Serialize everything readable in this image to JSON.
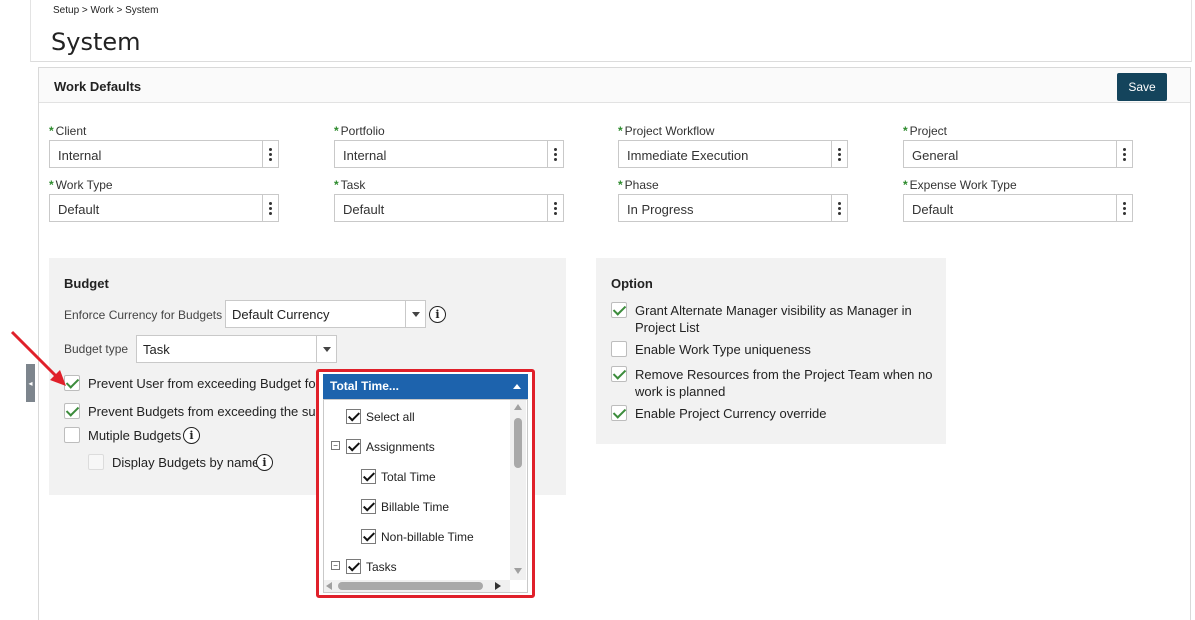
{
  "breadcrumb": "Setup > Work > System",
  "page_title": "System",
  "panel": {
    "title": "Work Defaults",
    "save_label": "Save"
  },
  "fields": [
    {
      "label": "Client",
      "value": "Internal"
    },
    {
      "label": "Portfolio",
      "value": "Internal"
    },
    {
      "label": "Project Workflow",
      "value": "Immediate Execution"
    },
    {
      "label": "Project",
      "value": "General"
    },
    {
      "label": "Work Type",
      "value": "Default"
    },
    {
      "label": "Task",
      "value": "Default"
    },
    {
      "label": "Phase",
      "value": "In Progress"
    },
    {
      "label": "Expense Work Type",
      "value": "Default"
    }
  ],
  "required_mark": "*",
  "budget": {
    "title": "Budget",
    "enforce_currency_label": "Enforce Currency for Budgets",
    "enforce_currency_value": "Default Currency",
    "budget_type_label": "Budget type",
    "budget_type_value": "Task",
    "options": [
      {
        "label": "Prevent User from exceeding Budget for",
        "checked": true
      },
      {
        "label": "Prevent Budgets from exceeding the sun",
        "checked": true
      },
      {
        "label": "Mutiple Budgets",
        "checked": false
      },
      {
        "label": "Display Budgets by name",
        "checked": false
      }
    ]
  },
  "option": {
    "title": "Option",
    "items": [
      {
        "label_line1": "Grant Alternate Manager visibility as Manager in",
        "label_line2": "Project List",
        "checked": true
      },
      {
        "label_line1": "Enable Work Type uniqueness",
        "label_line2": "",
        "checked": false
      },
      {
        "label_line1": "Remove Resources from the Project Team when no",
        "label_line2": "work is planned",
        "checked": true
      },
      {
        "label_line1": "Enable Project Currency override",
        "label_line2": "",
        "checked": true
      }
    ]
  },
  "dropdown": {
    "title": "Total Time...",
    "items": [
      {
        "label": "Select all",
        "checked": true
      },
      {
        "label": "Assignments",
        "checked": true,
        "collapse": "⊟"
      },
      {
        "label": "Total Time",
        "checked": true
      },
      {
        "label": "Billable Time",
        "checked": true
      },
      {
        "label": "Non-billable Time",
        "checked": true
      },
      {
        "label": "Tasks",
        "checked": true,
        "collapse": "⊟"
      }
    ]
  },
  "info_glyph": "i",
  "collapse_glyph": "−",
  "colors": {
    "accent": "#14445c",
    "dropdown_header": "#1d63ad",
    "highlight": "#e0202a",
    "check_green": "#3c8c3c"
  }
}
